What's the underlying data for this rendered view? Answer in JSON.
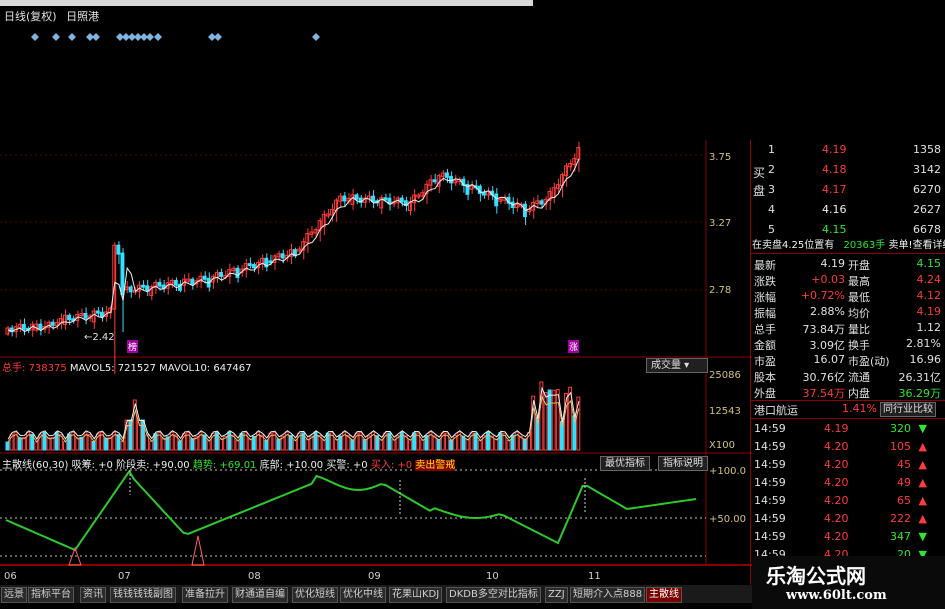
{
  "header": {
    "period": "日线(复权)",
    "stock_name": "日照港"
  },
  "price_axis": [
    "3.75",
    "3.27",
    "2.78"
  ],
  "low_marker": "2.42",
  "candle_tags": [
    "榜",
    "涨"
  ],
  "volume_legend": {
    "total": "总手: 738375",
    "ma5": "MAVOL5: 721527",
    "ma10": "MAVOL10: 647467",
    "selector": "成交量"
  },
  "volume_axis": [
    "25086",
    "12543",
    "X100"
  ],
  "indicator_legend": {
    "name": "主散线(60,30)",
    "items": [
      "吸筹: +0",
      "阶段卖: +90.00",
      "趋势: +69.01",
      "底部: +10.00",
      "买警: +0",
      "买入: +0",
      "卖出警戒"
    ],
    "btn_opt": "最优指标",
    "btn_help": "指标说明"
  },
  "indicator_axis": [
    "+100.0",
    "+50.00"
  ],
  "dates": [
    "06",
    "07",
    "08",
    "09",
    "10",
    "11"
  ],
  "tabs": [
    "远景",
    "指标平台",
    "资讯",
    "钱钱钱钱副图",
    "准备拉升",
    "财通道自编",
    "优化短线",
    "优化中线",
    "花果山KDJ",
    "DKDB多空对比指标",
    "ZZJ",
    "短期介入点888",
    "主散线"
  ],
  "orderbook": {
    "side_label": "买盘",
    "rows": [
      {
        "level": "1",
        "price": "4.19",
        "qty": "1358"
      },
      {
        "level": "2",
        "price": "4.18",
        "qty": "3142"
      },
      {
        "level": "3",
        "price": "4.17",
        "qty": "6270"
      },
      {
        "level": "4",
        "price": "4.16",
        "qty": "2627"
      },
      {
        "level": "5",
        "price": "4.15",
        "qty": "6678"
      }
    ],
    "notice_left": "在卖盘4.25位置有",
    "notice_qty": "20363手",
    "notice_right": "卖单!查看详细"
  },
  "stats": [
    {
      "l1": "最新",
      "v1": "4.19",
      "l2": "开盘",
      "v2": "4.15"
    },
    {
      "l1": "涨跌",
      "v1": "+0.03",
      "l2": "最高",
      "v2": "4.24"
    },
    {
      "l1": "涨幅",
      "v1": "+0.72%",
      "l2": "最低",
      "v2": "4.12"
    },
    {
      "l1": "振幅",
      "v1": "2.88%",
      "l2": "均价",
      "v2": "4.19"
    },
    {
      "l1": "总手",
      "v1": "73.84万",
      "l2": "量比",
      "v2": "1.12"
    },
    {
      "l1": "金额",
      "v1": "3.09亿",
      "l2": "换手",
      "v2": "2.81%"
    },
    {
      "l1": "市盈",
      "v1": "16.07",
      "l2": "市盈(动)",
      "v2": "16.96"
    },
    {
      "l1": "股本",
      "v1": "30.76亿",
      "l2": "流通",
      "v2": "26.31亿"
    },
    {
      "l1": "外盘",
      "v1": "37.54万",
      "l2": "内盘",
      "v2": "36.29万"
    }
  ],
  "sector": {
    "name": "港口航运",
    "pct": "1.41%",
    "btn": "同行业比较"
  },
  "trades": [
    {
      "time": "14:59",
      "price": "4.19",
      "qty": "320"
    },
    {
      "time": "14:59",
      "price": "4.20",
      "qty": "105"
    },
    {
      "time": "14:59",
      "price": "4.20",
      "qty": "45"
    },
    {
      "time": "14:59",
      "price": "4.20",
      "qty": "49"
    },
    {
      "time": "14:59",
      "price": "4.20",
      "qty": "65"
    },
    {
      "time": "14:59",
      "price": "4.20",
      "qty": "222"
    },
    {
      "time": "14:59",
      "price": "4.20",
      "qty": "347"
    },
    {
      "time": "14:59",
      "price": "4.20",
      "qty": "20"
    }
  ],
  "watermark": {
    "line1": "乐淘公式网",
    "line2": "www.60lt.com"
  },
  "colors": {
    "up": "#ff3b3b",
    "down": "#33e0ff",
    "ma": "#f0f0f0",
    "indicator_line": "#2ec82e",
    "accent": "#ffe000"
  }
}
